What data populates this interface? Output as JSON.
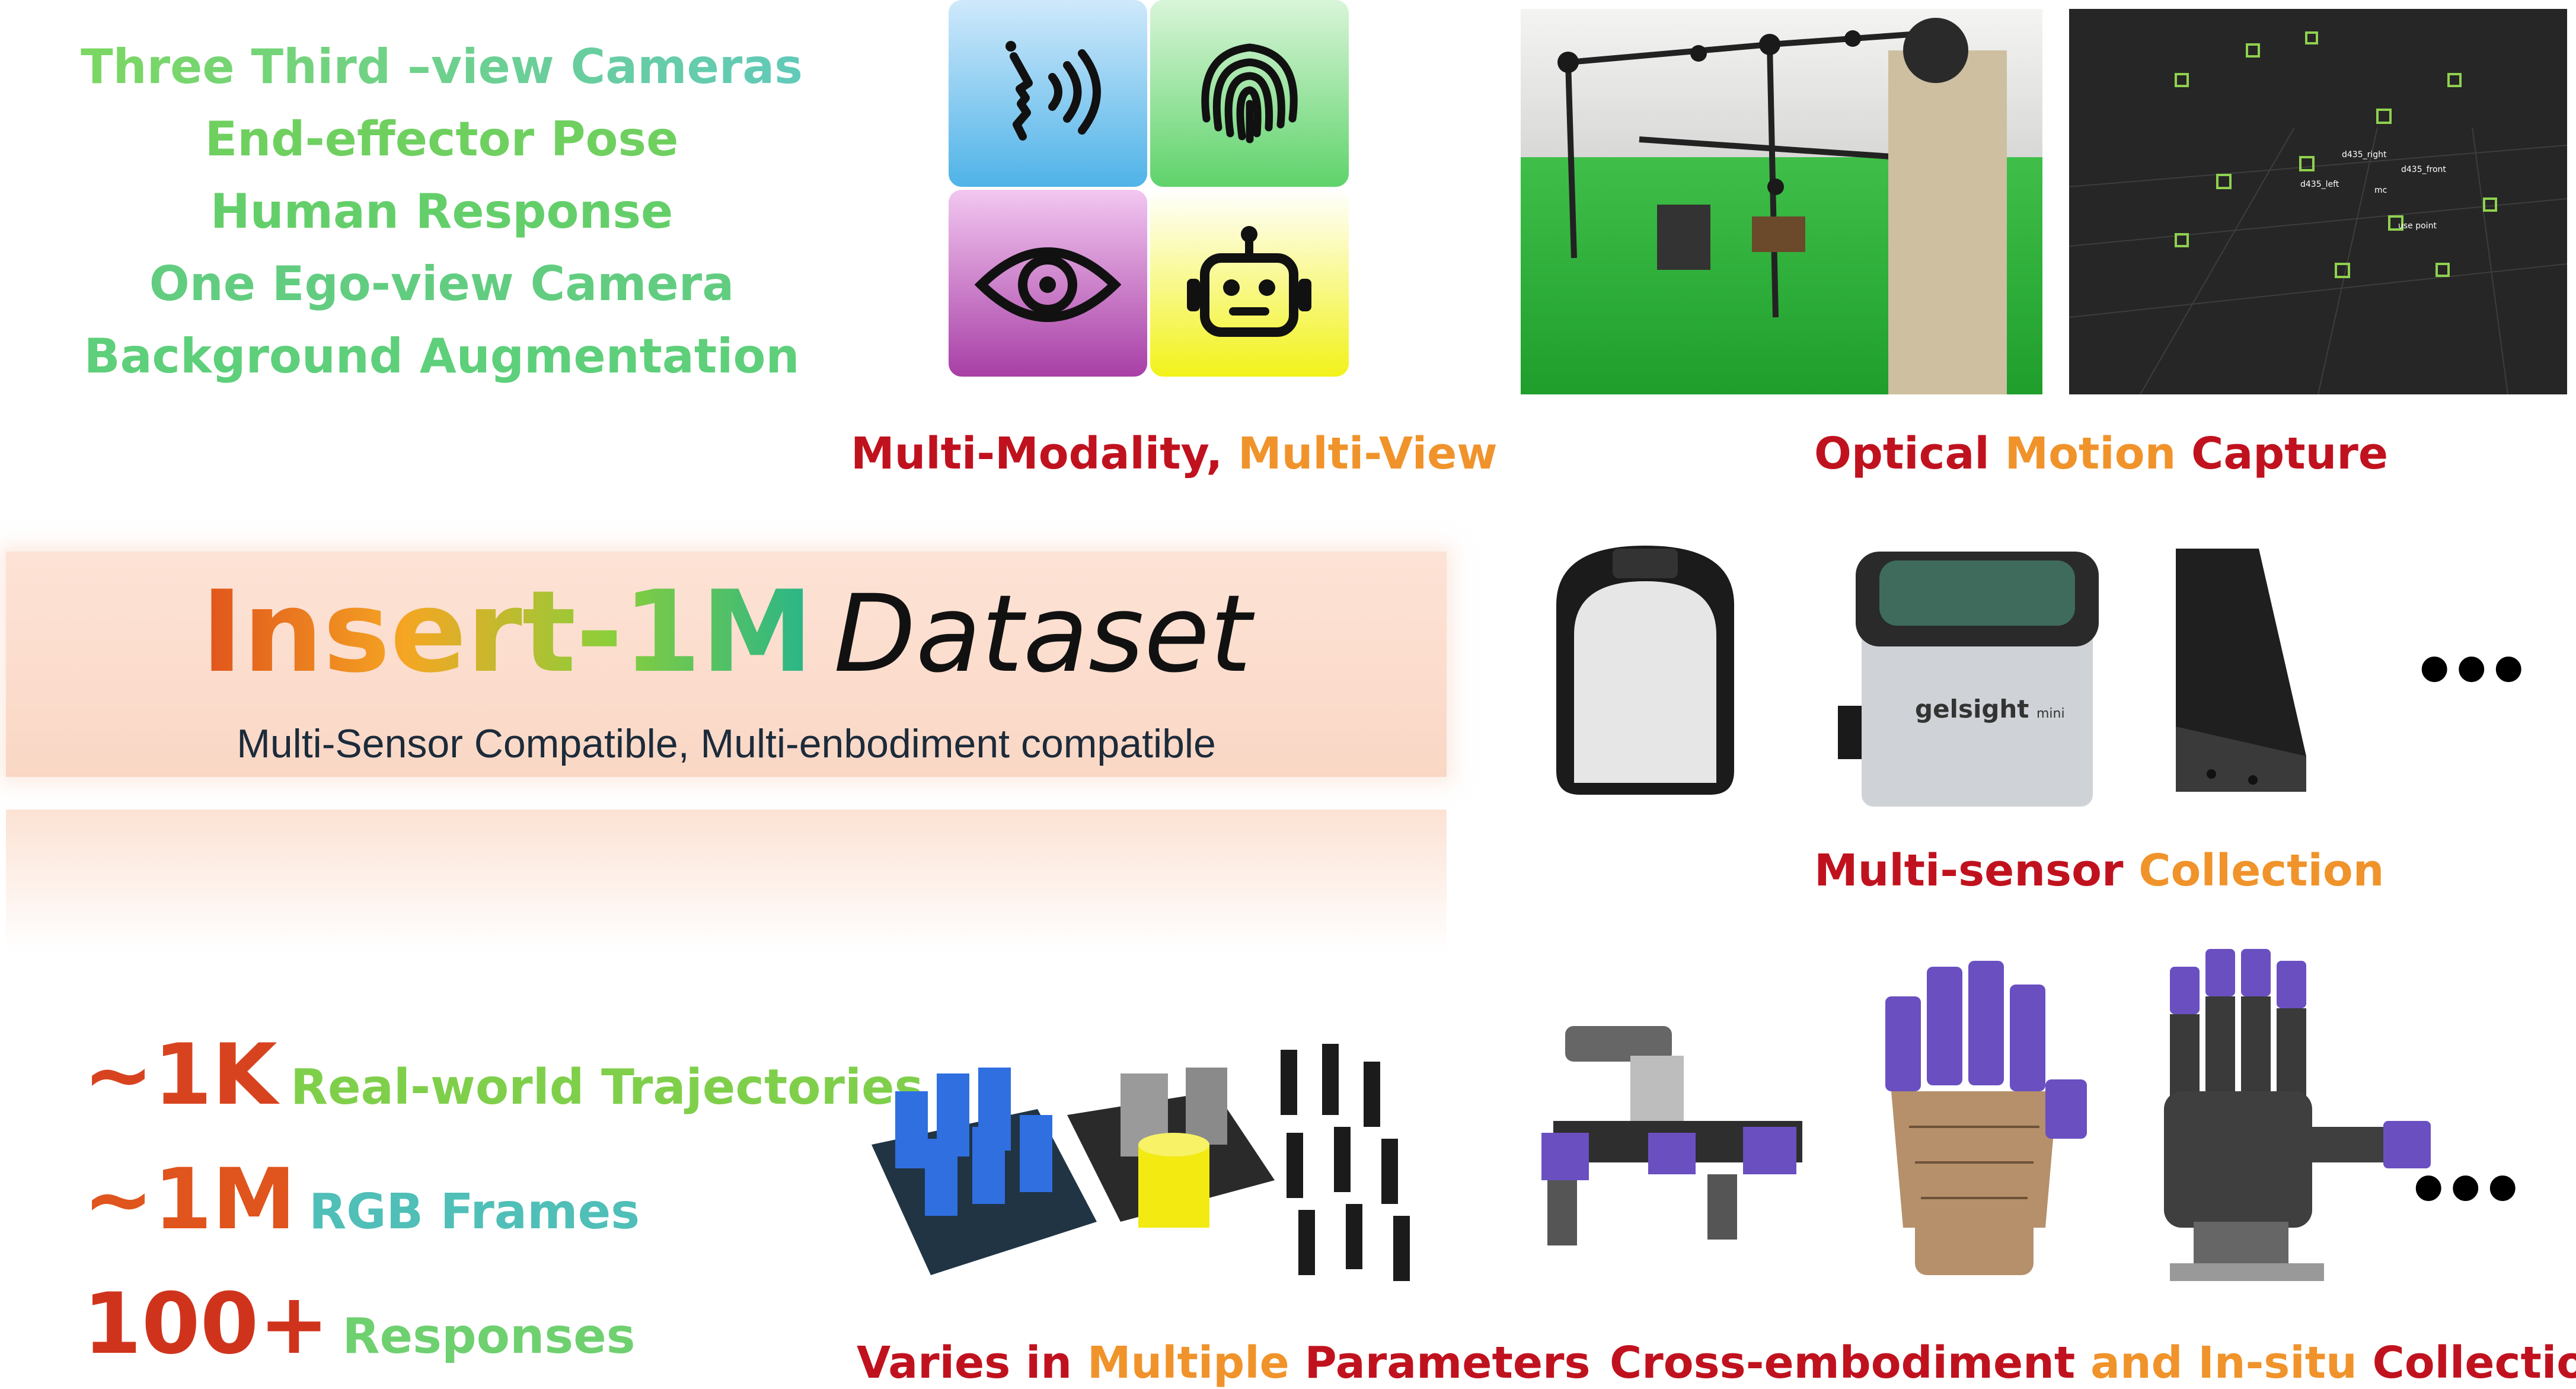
{
  "features": [
    "Three Third –view Cameras",
    "End-effector Pose",
    "Human Response",
    "One Ego-view Camera",
    "Background Augmentation"
  ],
  "captions": {
    "modality_a": "Multi-Modality,",
    "modality_b": " Multi-View",
    "optical_a": "Optical",
    "optical_b": " Motion",
    "optical_c": " Capture",
    "sensor_a": "Multi-sensor",
    "sensor_b": " Collection",
    "varies_a": "Varies in",
    "varies_b": " Multiple",
    "varies_c": " Parameters",
    "cross_a": "Cross-embodiment",
    "cross_b": "  and In-situ",
    "cross_c": " Collection"
  },
  "dataset": {
    "name_colored": "Insert-1M",
    "name_suffix": "Dataset",
    "subtitle": "Multi-Sensor Compatible, Multi-enbodiment compatible"
  },
  "stats": [
    {
      "value": "~1K",
      "label": "Real-world Trajectories"
    },
    {
      "value": "~1M",
      "label": "RGB Frames"
    },
    {
      "value": "100+",
      "label": "Responses"
    }
  ],
  "mocap_labels": [
    "d435_right",
    "d435_front",
    "d435_left",
    "mc",
    "use point"
  ],
  "sensor_logo": {
    "brand": "gelsight",
    "model": "mini"
  },
  "ellipsis": "•••",
  "icons": [
    "speech-icon",
    "fingerprint-icon",
    "eye-icon",
    "robot-icon"
  ],
  "colors": {
    "feature_start": "#7ed957",
    "feature_end": "#5ec8c4",
    "caption_red": "#c0121e",
    "caption_orange": "#f0932b",
    "tile_blue": "#4fb3e8",
    "tile_green": "#5fd36b",
    "tile_purple": "#a83fa6",
    "tile_yellow": "#f2f21a"
  }
}
